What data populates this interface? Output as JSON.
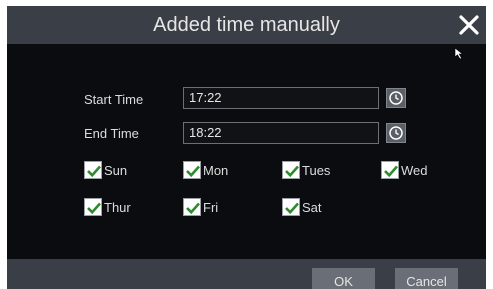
{
  "dialog": {
    "title": "Added time manually",
    "start_time_label": "Start Time",
    "start_time_value": "17:22",
    "end_time_label": "End Time",
    "end_time_value": "18:22",
    "days": [
      {
        "label": "Sun",
        "checked": true
      },
      {
        "label": "Mon",
        "checked": true
      },
      {
        "label": "Tues",
        "checked": true
      },
      {
        "label": "Wed",
        "checked": true
      },
      {
        "label": "Thur",
        "checked": true
      },
      {
        "label": "Fri",
        "checked": true
      },
      {
        "label": "Sat",
        "checked": true
      }
    ],
    "ok_label": "OK",
    "cancel_label": "Cancel"
  },
  "colors": {
    "checkmark": "#2e8b2e",
    "background": "#0b0c0f",
    "titlebar": "#3a3e46"
  }
}
